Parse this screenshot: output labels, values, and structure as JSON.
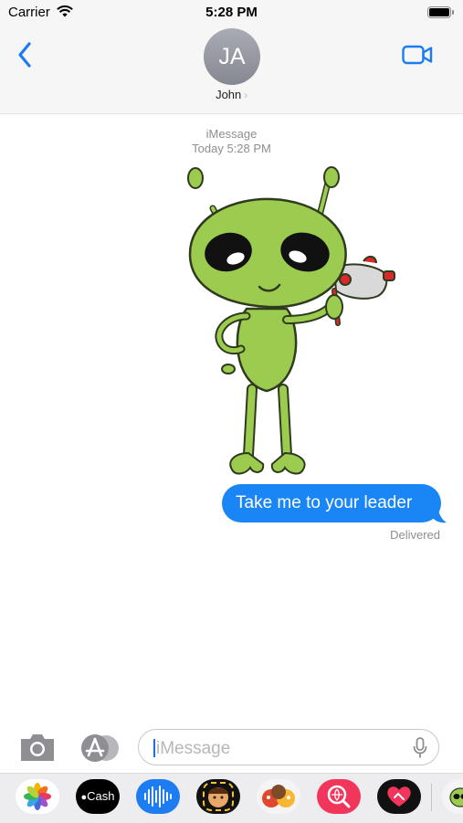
{
  "status_bar": {
    "carrier": "Carrier",
    "time": "5:28 PM"
  },
  "nav": {
    "avatar_initials": "JA",
    "contact_name": "John",
    "chevron": "›"
  },
  "conversation": {
    "service": "iMessage",
    "timestamp": "Today 5:28 PM",
    "sticker": "alien-with-ray-gun",
    "message": "Take me to your leader",
    "status": "Delivered"
  },
  "input": {
    "placeholder": "iMessage"
  },
  "apps": {
    "cash_label": "Cash",
    "items": [
      "photos-icon",
      "apple-cash-icon",
      "audio-message-icon",
      "memoji-icon",
      "animoji-icon",
      "search-images-icon",
      "digital-touch-icon",
      "alien-sticker-app-icon"
    ]
  },
  "colors": {
    "accent": "#1a86f5",
    "bubble": "#1a86f5",
    "alien_green": "#9ccc4f"
  }
}
